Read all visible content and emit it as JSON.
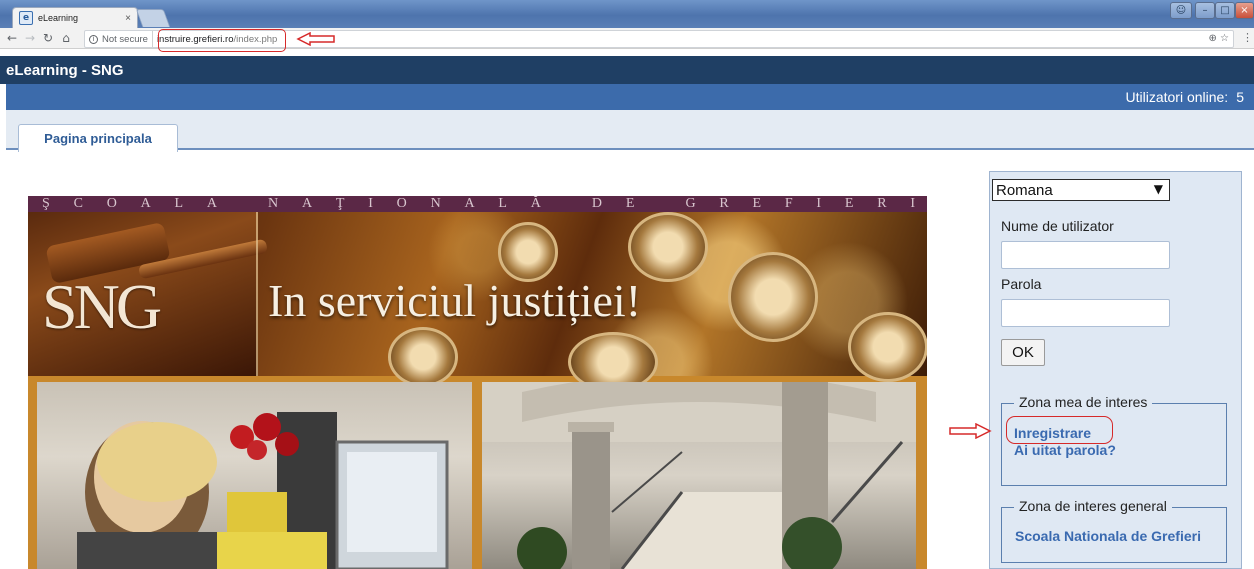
{
  "browser": {
    "tab_title": "eLearning",
    "tab_close": "×",
    "security_label": "Not secure",
    "url_host": "instruire.grefieri.ro",
    "url_path": "/index.php",
    "window_controls": {
      "minimize": "–",
      "maximize": "□",
      "close": "×"
    },
    "omni_icons": "⊕ ☆",
    "menu": "⋮"
  },
  "site": {
    "title": "eLearning - SNG",
    "online_label": "Utilizatori online:",
    "online_count": "5",
    "tab_label": "Pagina principala"
  },
  "banner": {
    "strip_letters": [
      "Ş",
      "C",
      "O",
      "A",
      "L",
      "A",
      "",
      "N",
      "A",
      "Ţ",
      "I",
      "O",
      "N",
      "A",
      "L",
      "Ă",
      "",
      "D",
      "E",
      "",
      "G",
      "R",
      "E",
      "F",
      "I",
      "E",
      "R",
      "I"
    ],
    "logo_text": "SNG",
    "slogan": "In serviciul justiției!"
  },
  "login": {
    "language_selected": "Romana",
    "username_label": "Nume de utilizator",
    "password_label": "Parola",
    "username_value": "",
    "password_value": "",
    "ok_label": "OK"
  },
  "interest": {
    "my_zone_title": "Zona mea de interes",
    "register_link": "Inregistrare",
    "forgot_link": "Ai uitat parola?",
    "general_zone_title": "Zona de interes general",
    "school_link": "Scoala Nationala de Grefieri"
  },
  "annotations": {
    "color": "#d62a2a"
  }
}
